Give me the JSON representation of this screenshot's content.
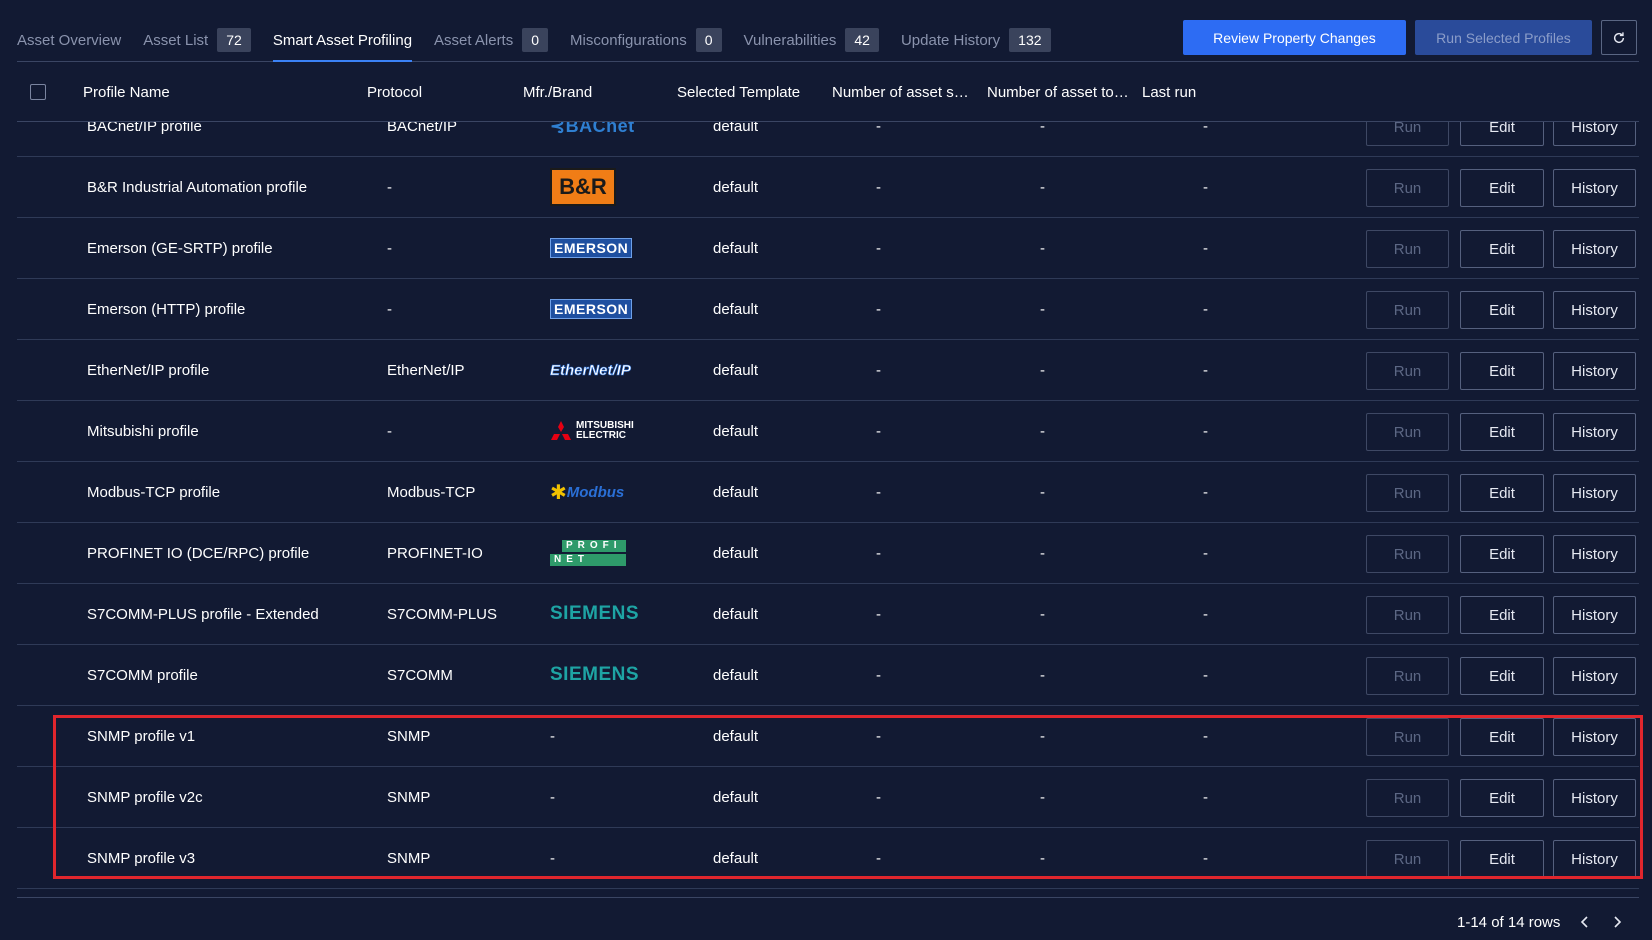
{
  "tabs": [
    {
      "label": "Asset Overview",
      "count": null
    },
    {
      "label": "Asset List",
      "count": "72"
    },
    {
      "label": "Smart Asset Profiling",
      "count": null
    },
    {
      "label": "Asset Alerts",
      "count": "0"
    },
    {
      "label": "Misconfigurations",
      "count": "0"
    },
    {
      "label": "Vulnerabilities",
      "count": "42"
    },
    {
      "label": "Update History",
      "count": "132"
    }
  ],
  "toolbar": {
    "review_label": "Review Property Changes",
    "run_selected_label": "Run Selected Profiles"
  },
  "columns": {
    "name": "Profile Name",
    "protocol": "Protocol",
    "brand": "Mfr./Brand",
    "template": "Selected Template",
    "num_supported": "Number of asset sup…",
    "num_to_be": "Number of asset to b…",
    "last_run": "Last run"
  },
  "actions": {
    "run": "Run",
    "edit": "Edit",
    "history": "History"
  },
  "rows": [
    {
      "name": "BACnet/IP profile",
      "protocol": "BACnet/IP",
      "brand": "BACnet",
      "template": "default",
      "n1": "-",
      "n2": "-",
      "last": "-"
    },
    {
      "name": "B&R Industrial Automation profile",
      "protocol": "-",
      "brand": "B&R",
      "template": "default",
      "n1": "-",
      "n2": "-",
      "last": "-"
    },
    {
      "name": "Emerson (GE-SRTP) profile",
      "protocol": "-",
      "brand": "EMERSON",
      "template": "default",
      "n1": "-",
      "n2": "-",
      "last": "-"
    },
    {
      "name": "Emerson (HTTP) profile",
      "protocol": "-",
      "brand": "EMERSON",
      "template": "default",
      "n1": "-",
      "n2": "-",
      "last": "-"
    },
    {
      "name": "EtherNet/IP profile",
      "protocol": "EtherNet/IP",
      "brand": "EtherNet/IP",
      "template": "default",
      "n1": "-",
      "n2": "-",
      "last": "-"
    },
    {
      "name": "Mitsubishi profile",
      "protocol": "-",
      "brand": "MITSUBISHI ELECTRIC",
      "template": "default",
      "n1": "-",
      "n2": "-",
      "last": "-"
    },
    {
      "name": "Modbus-TCP profile",
      "protocol": "Modbus-TCP",
      "brand": "Modbus",
      "template": "default",
      "n1": "-",
      "n2": "-",
      "last": "-"
    },
    {
      "name": "PROFINET IO (DCE/RPC) profile",
      "protocol": "PROFINET-IO",
      "brand": "PROFINET",
      "template": "default",
      "n1": "-",
      "n2": "-",
      "last": "-"
    },
    {
      "name": "S7COMM-PLUS profile - Extended",
      "protocol": "S7COMM-PLUS",
      "brand": "SIEMENS",
      "template": "default",
      "n1": "-",
      "n2": "-",
      "last": "-"
    },
    {
      "name": "S7COMM profile",
      "protocol": "S7COMM",
      "brand": "SIEMENS",
      "template": "default",
      "n1": "-",
      "n2": "-",
      "last": "-"
    },
    {
      "name": "SNMP profile v1",
      "protocol": "SNMP",
      "brand": "-",
      "template": "default",
      "n1": "-",
      "n2": "-",
      "last": "-"
    },
    {
      "name": "SNMP profile v2c",
      "protocol": "SNMP",
      "brand": "-",
      "template": "default",
      "n1": "-",
      "n2": "-",
      "last": "-"
    },
    {
      "name": "SNMP profile v3",
      "protocol": "SNMP",
      "brand": "-",
      "template": "default",
      "n1": "-",
      "n2": "-",
      "last": "-"
    }
  ],
  "pagination": {
    "info": "1-14 of 14 rows"
  },
  "colors": {
    "background": "#121a33",
    "accent": "#2d6cf3",
    "highlight": "#e1262d"
  }
}
